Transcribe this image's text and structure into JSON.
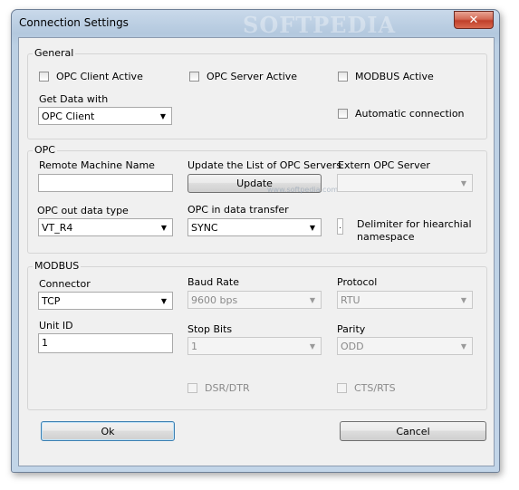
{
  "window": {
    "title": "Connection Settings",
    "watermark": "SOFTPEDIA",
    "watermark_small": "www.softpedia.com",
    "close_glyph": "✕"
  },
  "general": {
    "title": "General",
    "opc_client_active": "OPC Client Active",
    "opc_server_active": "OPC Server Active",
    "modbus_active": "MODBUS Active",
    "get_data_with_label": "Get Data with",
    "get_data_with_value": "OPC Client",
    "automatic_connection": "Automatic connection"
  },
  "opc": {
    "title": "OPC",
    "remote_machine_label": "Remote Machine Name",
    "remote_machine_value": "",
    "update_list_label": "Update the List of OPC Servers",
    "update_button": "Update",
    "extern_server_label": "Extern OPC Server",
    "extern_server_value": "",
    "out_type_label": "OPC out data type",
    "out_type_value": "VT_R4",
    "in_transfer_label": "OPC in data transfer",
    "in_transfer_value": "SYNC",
    "delimiter_value": ".",
    "delimiter_label_1": "Delimiter for hiearchial",
    "delimiter_label_2": "namespace"
  },
  "modbus": {
    "title": "MODBUS",
    "connector_label": "Connector",
    "connector_value": "TCP",
    "baud_label": "Baud Rate",
    "baud_value": "9600 bps",
    "protocol_label": "Protocol",
    "protocol_value": "RTU",
    "unit_id_label": "Unit ID",
    "unit_id_value": "1",
    "stop_bits_label": "Stop Bits",
    "stop_bits_value": "1",
    "parity_label": "Parity",
    "parity_value": "ODD",
    "dsr_dtr": "DSR/DTR",
    "cts_rts": "CTS/RTS"
  },
  "buttons": {
    "ok": "Ok",
    "cancel": "Cancel"
  },
  "icons": {
    "dropdown": "chevron-down-icon",
    "close": "close-icon"
  }
}
